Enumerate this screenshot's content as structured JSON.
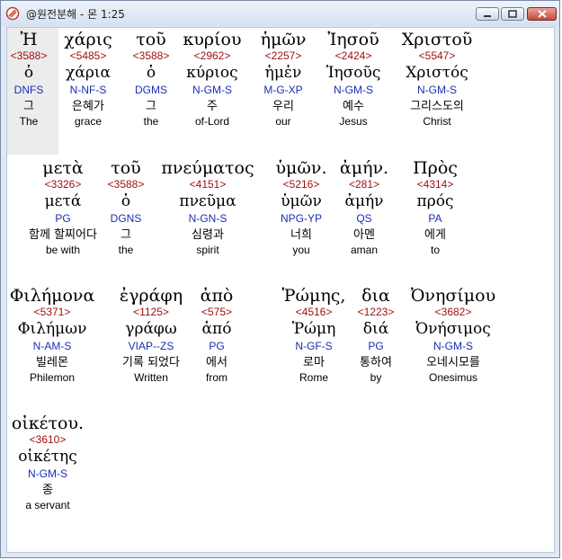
{
  "window": {
    "title": "@원전분해 - 몬 1:25"
  },
  "rows": [
    {
      "words": [
        {
          "greek": "Ἡ",
          "strong": "<3588>",
          "lemma": "ὁ",
          "morph": "DNFS",
          "korean": "그",
          "english": "The"
        },
        {
          "greek": "χάρις",
          "strong": "<5485>",
          "lemma": "χάρια",
          "morph": "N-NF-S",
          "korean": "은혜가",
          "english": "grace"
        },
        {
          "greek": "τοῦ",
          "strong": "<3588>",
          "lemma": "ὁ",
          "morph": "DGMS",
          "korean": "그",
          "english": "the"
        },
        {
          "greek": "κυρίου",
          "strong": "<2962>",
          "lemma": "κύριος",
          "morph": "N-GM-S",
          "korean": "주",
          "english": "of-Lord"
        },
        {
          "greek": "ἡμῶν",
          "strong": "<2257>",
          "lemma": "ἡμἐν",
          "morph": "M-G-XP",
          "korean": "우리",
          "english": "our"
        },
        {
          "greek": "Ἰησοῦ",
          "strong": "<2424>",
          "lemma": "Ἰησοῦς",
          "morph": "N-GM-S",
          "korean": "예수",
          "english": "Jesus"
        },
        {
          "greek": "Χριστοῦ",
          "strong": "<5547>",
          "lemma": "Χριστός",
          "morph": "N-GM-S",
          "korean": "그리스도의",
          "english": "Christ"
        }
      ]
    },
    {
      "words": [
        {
          "greek": "μετὰ",
          "strong": "<3326>",
          "lemma": "μετά",
          "morph": "PG",
          "korean": "함께 할찌어다",
          "english": "be with"
        },
        {
          "greek": "τοῦ",
          "strong": "<3588>",
          "lemma": "ὁ",
          "morph": "DGNS",
          "korean": "그",
          "english": "the"
        },
        {
          "greek": "πνεύματος",
          "strong": "<4151>",
          "lemma": "πνεῦμα",
          "morph": "N-GN-S",
          "korean": "심령과",
          "english": "spirit"
        },
        {
          "greek": "ὑμῶν.",
          "strong": "<5216>",
          "lemma": "ὑμῶν",
          "morph": "NPG-YP",
          "korean": "너희",
          "english": "you"
        },
        {
          "greek": "ἀμήν.",
          "strong": "<281>",
          "lemma": "ἀμήν",
          "morph": "QS",
          "korean": "아멘",
          "english": "aman"
        },
        {
          "greek": "Πρὸς",
          "strong": "<4314>",
          "lemma": "πρός",
          "morph": "PA",
          "korean": "에게",
          "english": "to"
        }
      ]
    },
    {
      "words": [
        {
          "greek": "Φιλήμονα",
          "strong": "<5371>",
          "lemma": "Φιλήμων",
          "morph": "N-AM-S",
          "korean": "빌레몬",
          "english": "Philemon"
        },
        {
          "greek": "ἐγράφη",
          "strong": "<1125>",
          "lemma": "γράφω",
          "morph": "VIAP--ZS",
          "korean": "기록 되었다",
          "english": "Written"
        },
        {
          "greek": "ἀπὸ",
          "strong": "<575>",
          "lemma": "ἀπό",
          "morph": "PG",
          "korean": "에서",
          "english": "from"
        },
        {
          "greek": "Ῥώμης,",
          "strong": "<4516>",
          "lemma": "Ῥώμη",
          "morph": "N-GF-S",
          "korean": "로마",
          "english": "Rome"
        },
        {
          "greek": "δια",
          "strong": "<1223>",
          "lemma": "διά",
          "morph": "PG",
          "korean": "통하여",
          "english": "by"
        },
        {
          "greek": "Ὀνησίμου",
          "strong": "<3682>",
          "lemma": "Ὀνήσιμος",
          "morph": "N-GM-S",
          "korean": "오네시모를",
          "english": "Onesimus"
        }
      ]
    },
    {
      "words": [
        {
          "greek": "οἰκέτου.",
          "strong": "<3610>",
          "lemma": "οἰκέτης",
          "morph": "N-GM-S",
          "korean": "종",
          "english": "a servant"
        }
      ]
    }
  ]
}
